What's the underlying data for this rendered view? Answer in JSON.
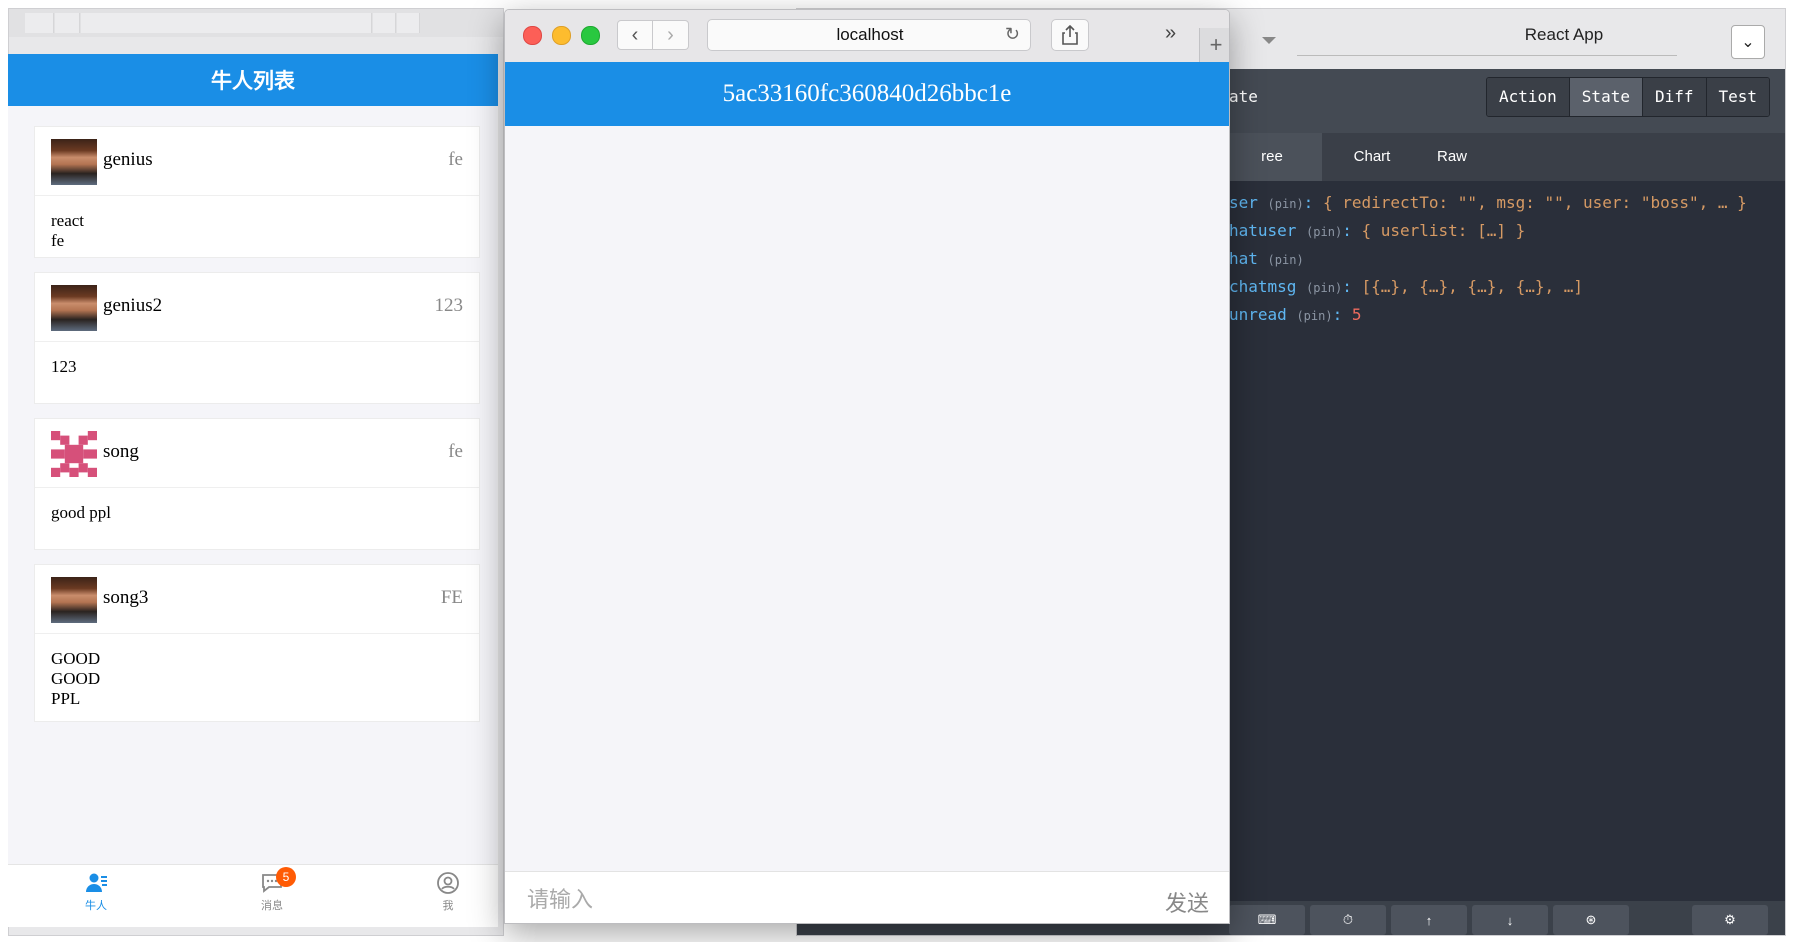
{
  "left_app": {
    "header_title": "牛人列表",
    "cards": [
      {
        "name": "genius",
        "title": "fe",
        "desc_lines": [
          "react",
          "fe"
        ],
        "avatar": "man"
      },
      {
        "name": "genius2",
        "title": "123",
        "desc_lines": [
          "123"
        ],
        "avatar": "man"
      },
      {
        "name": "song",
        "title": "fe",
        "desc_lines": [
          "good ppl"
        ],
        "avatar": "pixel"
      },
      {
        "name": "song3",
        "title": "FE",
        "desc_lines": [
          "GOOD",
          "GOOD",
          "PPL"
        ],
        "avatar": "man"
      }
    ],
    "tabbar": {
      "items": [
        {
          "label": "牛人",
          "icon": "users-icon",
          "active": true
        },
        {
          "label": "消息",
          "icon": "message-icon",
          "badge": "5"
        },
        {
          "label": "我",
          "icon": "profile-icon"
        }
      ]
    },
    "accent_color": "#1a8ee6"
  },
  "safari": {
    "url": "localhost",
    "chat_title": "5ac33160fc360840d26bbc1e",
    "input_placeholder": "请输入",
    "send_label": "发送"
  },
  "devtools": {
    "window_title": "React App",
    "filter_partial": "ate",
    "tabs": [
      "Action",
      "State",
      "Diff",
      "Test"
    ],
    "active_tab": "State",
    "subtabs": [
      "ree",
      "Chart",
      "Raw"
    ],
    "state_tree": [
      {
        "key": "ser",
        "pin": "(pin)",
        "sep": ": ",
        "value": "{ redirectTo: \"\", msg: \"\", user: \"boss\", … }"
      },
      {
        "key": "hatuser",
        "pin": "(pin)",
        "sep": ": ",
        "value": "{ userlist: […] }"
      },
      {
        "key": "hat",
        "pin": "(pin)",
        "sep": "",
        "value": ""
      },
      {
        "key": "chatmsg",
        "pin": "(pin)",
        "sep": ": ",
        "value": "[{…}, {…}, {…}, {…}, …]"
      },
      {
        "key": "unread",
        "pin": "(pin)",
        "sep": ": ",
        "value": "5"
      }
    ],
    "bottom_icons": [
      "keyboard-icon",
      "timer-icon",
      "upload-icon",
      "download-icon",
      "remote-icon",
      "settings-icon"
    ]
  }
}
